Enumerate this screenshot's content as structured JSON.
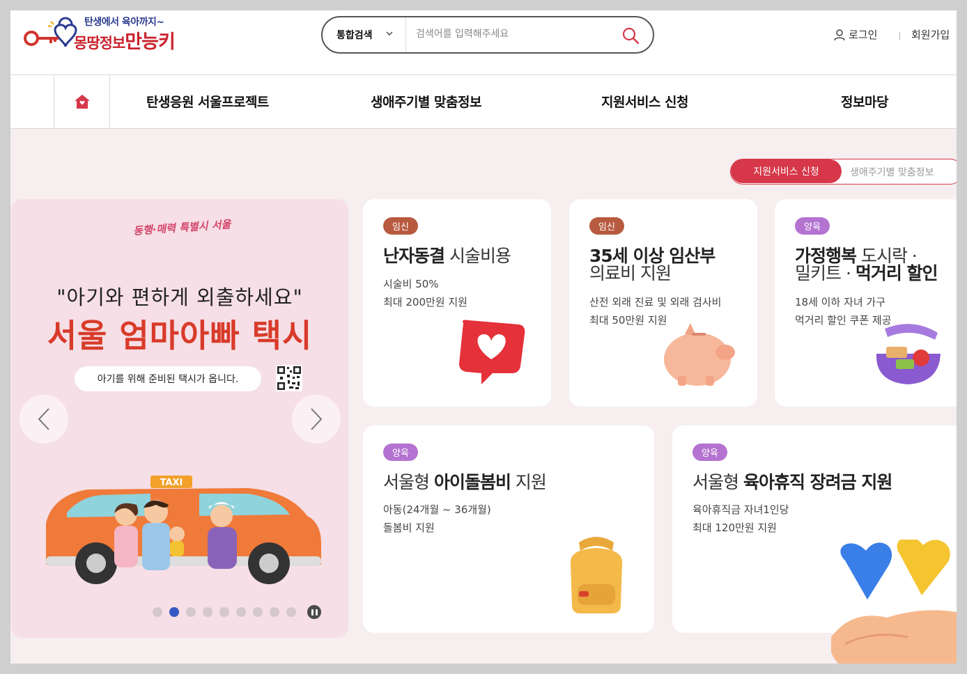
{
  "header": {
    "logo": {
      "subtitle": "탄생에서 육아까지~",
      "title_a": "몽땅정보",
      "title_b": "만능키"
    },
    "search": {
      "type_label": "통합검색",
      "placeholder": "검색어를 입력해주세요"
    },
    "login_label": "로그인",
    "signup_label": "회원가입"
  },
  "nav": {
    "items": [
      {
        "label": "탄생응원 서울프로젝트"
      },
      {
        "label": "생애주기별 맞춤정보"
      },
      {
        "label": "지원서비스 신청"
      },
      {
        "label": "정보마당"
      }
    ]
  },
  "toggle": {
    "active": "지원서비스 신청",
    "inactive": "생애주기별 맞춤정보"
  },
  "banner": {
    "slogan": "동행·매력 특별시 서울",
    "quote": "\"아기와 편하게 외출하세요\"",
    "title": "서울 엄마아빠 택시",
    "pill": "아기를 위해 준비된 택시가 옵니다.",
    "taxi_sign": "TAXI",
    "slide_count": 9,
    "active_slide": 2
  },
  "cards": [
    {
      "badge": "임신",
      "title_bold": "난자동결",
      "title_rest": " 시술비용",
      "line1": "시술비 50%",
      "line2": "최대 200만원 지원"
    },
    {
      "badge": "임신",
      "title_bold": "35세 이상 임산부",
      "title_rest": "의료비 지원",
      "line1": "산전 외래 진료 및 외래 검사비",
      "line2": "최대 50만원 지원"
    },
    {
      "badge": "양육",
      "title_bold": "가정행복",
      "title_rest": " 도시락 ·",
      "title_line2_rest": "밀키트 · ",
      "title_line2_bold": "먹거리 할인",
      "line1": "18세 이하 자녀 가구",
      "line2": "먹거리 할인 쿠폰 제공"
    },
    {
      "badge": "양육",
      "title_pre": "서울형 ",
      "title_bold": "아이돌봄비",
      "title_rest": " 지원",
      "line1": "아동(24개월 ~ 36개월)",
      "line2": "돌봄비 지원"
    },
    {
      "badge": "양육",
      "title_pre": "서울형 ",
      "title_bold": "육아휴직 장려금 지원",
      "line1": "육아휴직금 자녀1인당",
      "line2": "최대 120만원 지원"
    }
  ],
  "colors": {
    "accent": "#d6384a",
    "pregnancy_badge": "#b85a3f",
    "parenting_badge": "#b473d1",
    "page_bg": "#f6eeef"
  }
}
